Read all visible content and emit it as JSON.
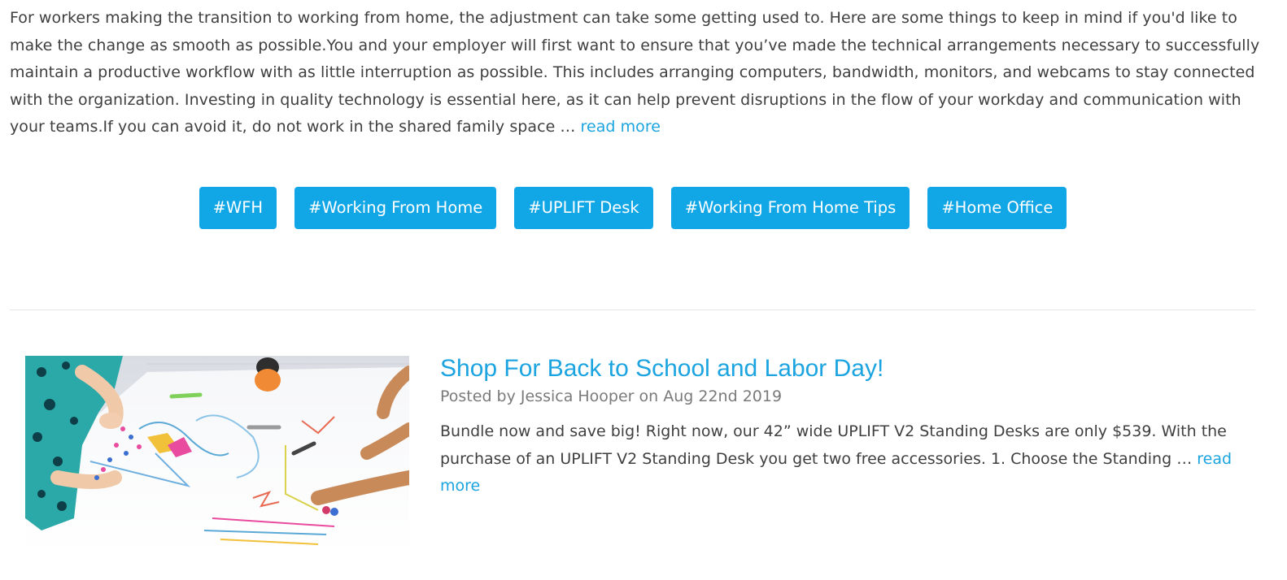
{
  "post1": {
    "excerpt": "For workers making the transition to working from home, the adjustment can take some getting used to. Here are some things to keep in mind if you'd like to make the change as smooth as possible.You and your employer will first want to ensure that you’ve made the technical arrangements necessary to successfully maintain a productive workflow with as little interruption as possible. This includes arranging computers, bandwidth, monitors, and webcams to stay connected with the organization. Investing in quality technology is essential here, as it can help prevent disruptions in the flow of your workday and communication with your teams.If you can avoid it, do not work in the shared family space …",
    "read_more": "read more",
    "tags": [
      "#WFH",
      "#Working From Home",
      "#UPLIFT Desk",
      "#Working From Home Tips",
      "#Home Office"
    ]
  },
  "post2": {
    "title": "Shop For Back to School and Labor Day!",
    "meta": "Posted by Jessica Hooper on Aug 22nd 2019",
    "summary": "Bundle now and save big! Right now, our 42” wide UPLIFT V2 Standing Desks are only $539. With the purchase of an UPLIFT V2 Standing Desk you get two free accessories. 1.  Choose the Standing …",
    "read_more": "read more"
  },
  "colors": {
    "accent": "#1ba4e0",
    "tag_bg": "#11a6e6",
    "text": "#3f3f3f",
    "meta": "#7a7a7a"
  }
}
